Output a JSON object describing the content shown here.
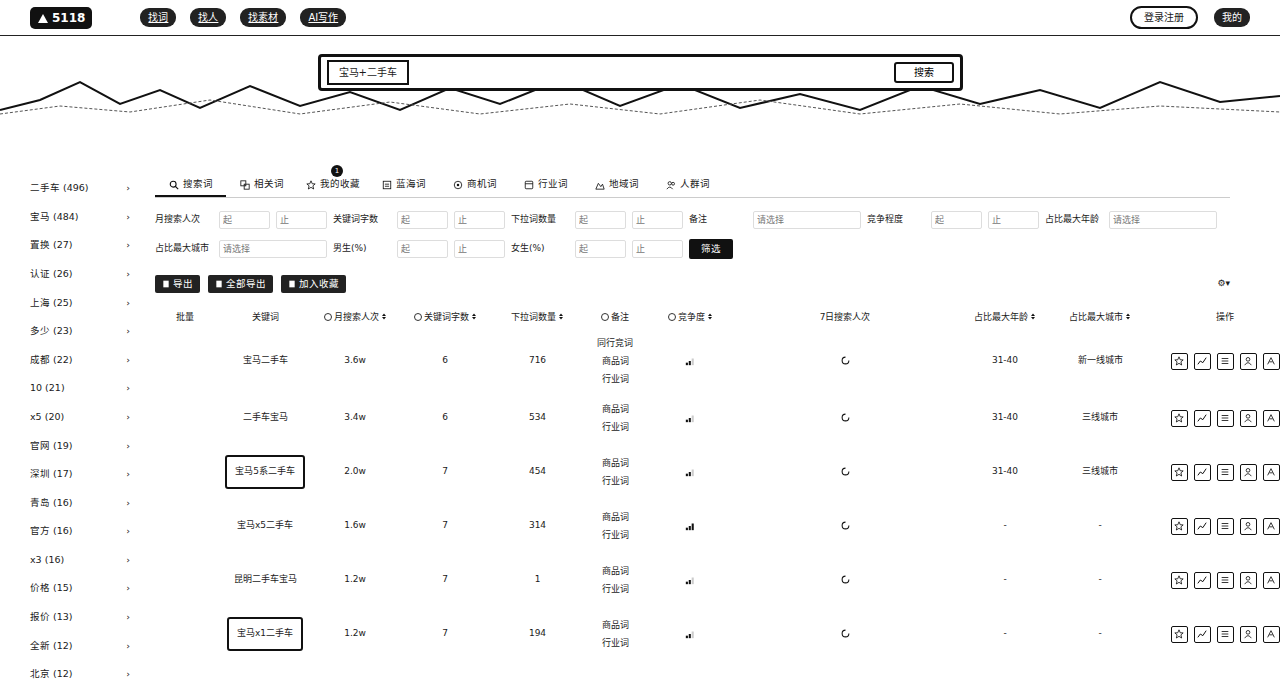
{
  "header": {
    "logo": "5118",
    "nav": [
      {
        "label": "找词"
      },
      {
        "label": "找人"
      },
      {
        "label": "找素材"
      },
      {
        "label": "AI写作"
      }
    ],
    "login": "登录注册",
    "mine": "我的"
  },
  "search": {
    "value": "宝马+二手车",
    "button": "搜索"
  },
  "sidebar": {
    "items": [
      {
        "label": "二手车 (496)",
        "chevron": "›"
      },
      {
        "label": "宝马 (484)",
        "chevron": "›"
      },
      {
        "label": "置换 (27)",
        "chevron": "›"
      },
      {
        "label": "认证 (26)",
        "chevron": "›"
      },
      {
        "label": "上海 (25)",
        "chevron": "›"
      },
      {
        "label": "多少 (23)",
        "chevron": "›"
      },
      {
        "label": "成都 (22)",
        "chevron": "›"
      },
      {
        "label": "10 (21)",
        "chevron": "›"
      },
      {
        "label": "x5 (20)",
        "chevron": "›"
      },
      {
        "label": "官网 (19)",
        "chevron": "›"
      },
      {
        "label": "深圳 (17)",
        "chevron": "›"
      },
      {
        "label": "青岛 (16)",
        "chevron": "›"
      },
      {
        "label": "官方 (16)",
        "chevron": "›"
      },
      {
        "label": "x3 (16)",
        "chevron": "›"
      },
      {
        "label": "价格 (15)",
        "chevron": "›"
      },
      {
        "label": "报价 (13)",
        "chevron": "›"
      },
      {
        "label": "全新 (12)",
        "chevron": "›"
      },
      {
        "label": "北京 (12)",
        "chevron": "›"
      }
    ]
  },
  "tabs": [
    {
      "label": "搜索词",
      "selected": true,
      "badge": ""
    },
    {
      "label": "相关词",
      "selected": false,
      "badge": ""
    },
    {
      "label": "我的收藏",
      "selected": false,
      "badge": "1"
    },
    {
      "label": "蓝海词",
      "selected": false,
      "badge": ""
    },
    {
      "label": "商机词",
      "selected": false,
      "badge": ""
    },
    {
      "label": "行业词",
      "selected": false,
      "badge": ""
    },
    {
      "label": "地域词",
      "selected": false,
      "badge": ""
    },
    {
      "label": "人群词",
      "selected": false,
      "badge": ""
    }
  ],
  "filters": [
    {
      "label": "月搜索人次",
      "kind": "range",
      "from": "起",
      "to": "止"
    },
    {
      "label": "关键词字数",
      "kind": "range",
      "from": "起",
      "to": "止"
    },
    {
      "label": "下拉词数量",
      "kind": "range",
      "from": "起",
      "to": "止"
    },
    {
      "label": "备注",
      "kind": "select",
      "placeholder": "请选择"
    },
    {
      "label": "竞争程度",
      "kind": "range",
      "from": "起",
      "to": "止"
    },
    {
      "label": "占比最大年龄",
      "kind": "select",
      "placeholder": "请选择"
    },
    {
      "label": "占比最大城市",
      "kind": "select",
      "placeholder": "请选择"
    },
    {
      "label": "男生(%)",
      "kind": "range",
      "from": "起",
      "to": "止"
    },
    {
      "label": "女生(%)",
      "kind": "range",
      "from": "起",
      "to": "止"
    }
  ],
  "filter_button": "筛选",
  "actions": [
    "导出",
    "全部导出",
    "加入收藏"
  ],
  "settings": "⚙▾",
  "table": {
    "columns": [
      {
        "label": "批量",
        "info": false,
        "sortable": false
      },
      {
        "label": "关键词",
        "info": false,
        "sortable": false
      },
      {
        "label": "月搜索人次",
        "info": true,
        "sortable": true
      },
      {
        "label": "关键词字数",
        "info": true,
        "sortable": true
      },
      {
        "label": "下拉词数量",
        "info": false,
        "sortable": true
      },
      {
        "label": "备注",
        "info": true,
        "sortable": false
      },
      {
        "label": "竞争度",
        "info": true,
        "sortable": true
      },
      {
        "label": "7日搜索人次",
        "info": false,
        "sortable": false
      },
      {
        "label": "占比最大年龄",
        "info": false,
        "sortable": true
      },
      {
        "label": "占比最大城市",
        "info": false,
        "sortable": true
      },
      {
        "label": "操作",
        "info": false,
        "sortable": false
      }
    ],
    "rows": [
      {
        "keyword": "宝马二手车",
        "highlighted": false,
        "volume": "3.6w",
        "length": "6",
        "dropdown": "716",
        "remarks": [
          "同行竞词",
          "商品词",
          "行业词"
        ],
        "competition": 0.67,
        "age": "31-40",
        "city": "新一线城市"
      },
      {
        "keyword": "二手车宝马",
        "highlighted": false,
        "volume": "3.4w",
        "length": "6",
        "dropdown": "534",
        "remarks": [
          "商品词",
          "行业词"
        ],
        "competition": 0.67,
        "age": "31-40",
        "city": "三线城市"
      },
      {
        "keyword": "宝马5系二手车",
        "highlighted": true,
        "volume": "2.0w",
        "length": "7",
        "dropdown": "454",
        "remarks": [
          "商品词",
          "行业词"
        ],
        "competition": 0.67,
        "age": "31-40",
        "city": "三线城市"
      },
      {
        "keyword": "宝马x5二手车",
        "highlighted": false,
        "volume": "1.6w",
        "length": "7",
        "dropdown": "314",
        "remarks": [
          "商品词",
          "行业词"
        ],
        "competition": 1,
        "age": "-",
        "city": "-"
      },
      {
        "keyword": "昆明二手车宝马",
        "highlighted": false,
        "volume": "1.2w",
        "length": "7",
        "dropdown": "1",
        "remarks": [
          "商品词",
          "行业词"
        ],
        "competition": 0.67,
        "age": "-",
        "city": "-"
      },
      {
        "keyword": "宝马x1二手车",
        "highlighted": true,
        "volume": "1.2w",
        "length": "7",
        "dropdown": "194",
        "remarks": [
          "商品词",
          "行业词"
        ],
        "competition": 0.67,
        "age": "-",
        "city": "-"
      }
    ]
  }
}
